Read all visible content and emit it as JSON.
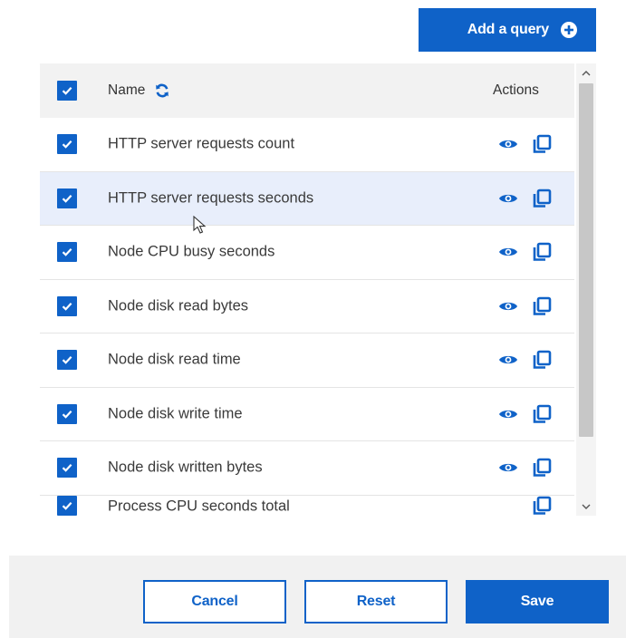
{
  "toolbar": {
    "add_query_label": "Add a query"
  },
  "table": {
    "header": {
      "name_label": "Name",
      "actions_label": "Actions"
    },
    "rows": [
      {
        "name": "HTTP server requests count",
        "checked": true
      },
      {
        "name": "HTTP server requests seconds",
        "checked": true,
        "highlighted": true
      },
      {
        "name": "Node CPU busy seconds",
        "checked": true
      },
      {
        "name": "Node disk read bytes",
        "checked": true
      },
      {
        "name": "Node disk read time",
        "checked": true
      },
      {
        "name": "Node disk write time",
        "checked": true
      },
      {
        "name": "Node disk written bytes",
        "checked": true
      },
      {
        "name": "Process CPU seconds total",
        "checked": true,
        "partially_visible": true
      }
    ]
  },
  "footer": {
    "cancel_label": "Cancel",
    "reset_label": "Reset",
    "save_label": "Save"
  },
  "icons": {
    "add": "add-circle-icon",
    "refresh": "refresh-icon",
    "view": "eye-icon",
    "copy": "copy-icon",
    "checkbox": "checkmark-icon",
    "scroll_up": "chevron-up-icon",
    "scroll_down": "chevron-down-icon"
  },
  "colors": {
    "primary": "#0f62c8",
    "header_bg": "#f2f2f2",
    "highlight_row": "#e8eefb",
    "footer_bg": "#f1f1f1"
  }
}
